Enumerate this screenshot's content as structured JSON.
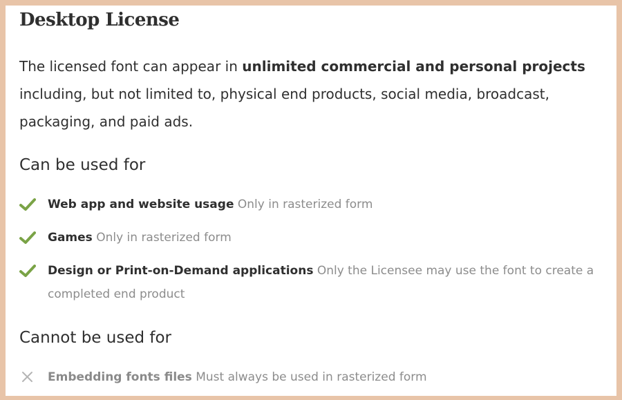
{
  "title": "Desktop License",
  "description": {
    "before": "The licensed font can appear in ",
    "bold": "unlimited commercial and personal projects",
    "after": " including, but not limited to, physical end products, social media, broadcast, packaging, and paid ads."
  },
  "can_use": {
    "heading": "Can be used for",
    "items": [
      {
        "name": "Web app and website usage",
        "note": "Only in rasterized form",
        "icon": "check-icon"
      },
      {
        "name": "Games",
        "note": "Only in rasterized form",
        "icon": "check-icon"
      },
      {
        "name": "Design or Print-on-Demand applications",
        "note": "Only the Licensee may use the font to create a completed end product",
        "icon": "check-icon"
      }
    ]
  },
  "cannot_use": {
    "heading": "Cannot be used for",
    "items": [
      {
        "name": "Embedding fonts files",
        "note": "Must always be used in rasterized form",
        "icon": "x-icon"
      }
    ]
  },
  "colors": {
    "check": "#7aa346",
    "cross": "#b5b5b5",
    "frame": "#e8c4a8",
    "muted_text": "#8c8c8c"
  }
}
